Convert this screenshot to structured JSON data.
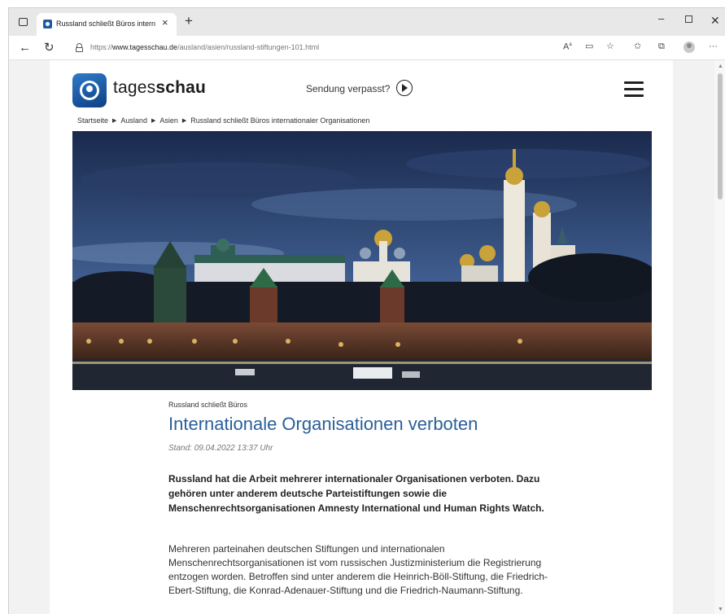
{
  "browser": {
    "tab": {
      "title": "Russland schließt Büros internati"
    },
    "address_bar": {
      "url_prefix": "https://",
      "url_host": "www.tagesschau.de",
      "url_path": "/ausland/asien/russland-stiftungen-101.html"
    },
    "toolbar_icons": [
      "read-aloud-icon",
      "immersive-reader-icon",
      "favorite-star-icon",
      "favorites-icon",
      "collections-icon",
      "profile-icon",
      "more-icon"
    ]
  },
  "site": {
    "brand_light": "tages",
    "brand_bold": "schau",
    "sendung_label": "Sendung verpasst?",
    "breadcrumb": [
      "Startseite",
      "Ausland",
      "Asien",
      "Russland schließt Büros internationaler Organisationen"
    ]
  },
  "article": {
    "kicker": "Russland schließt Büros",
    "headline": "Internationale Organisationen verboten",
    "stand": "Stand: 09.04.2022 13:37 Uhr",
    "lead": "Russland hat die Arbeit mehrerer internationaler Organisationen verboten. Dazu gehören unter anderem deutsche Parteistiftungen sowie die Menschenrechtsorganisationen Amnesty International und Human Rights Watch.",
    "body": "Mehreren parteinahen deutschen Stiftungen und internationalen Menschenrechtsorganisationen ist vom russischen Justizministerium die Registrierung entzogen worden. Betroffen sind unter anderem die Heinrich-Böll-Stiftung, die Friedrich-Ebert-Stiftung, die Konrad-Adenauer-Stiftung und die Friedrich-Naumann-Stiftung."
  },
  "colors": {
    "headline": "#2a5f99",
    "brand_blue": "#1d5aa5"
  }
}
